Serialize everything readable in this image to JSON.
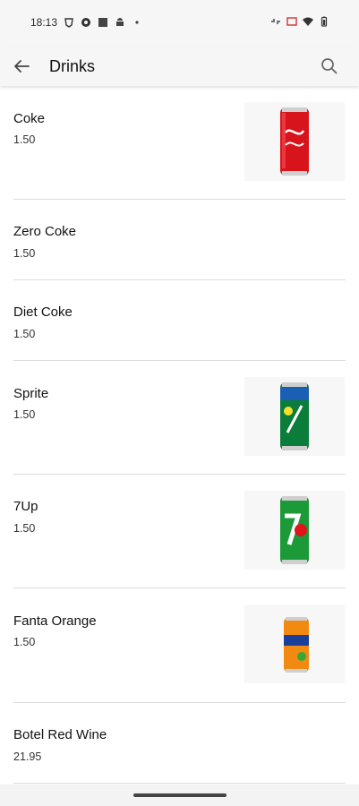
{
  "status_bar": {
    "time": "18:13",
    "left_icons": [
      "vpn-key-icon",
      "settings-icon",
      "square-app-icon",
      "android-icon",
      "dot-icon"
    ],
    "right_icons": [
      "link-icon",
      "cast-icon",
      "wifi-icon",
      "battery-icon"
    ]
  },
  "app_bar": {
    "title": "Drinks",
    "back_icon": "arrow-left-icon",
    "search_icon": "search-icon"
  },
  "items": [
    {
      "name": "Coke",
      "price": "1.50",
      "image": "coke-can"
    },
    {
      "name": "Zero Coke",
      "price": "1.50",
      "image": ""
    },
    {
      "name": "Diet Coke",
      "price": "1.50",
      "image": ""
    },
    {
      "name": "Sprite",
      "price": "1.50",
      "image": "sprite-can"
    },
    {
      "name": "7Up",
      "price": "1.50",
      "image": "7up-can"
    },
    {
      "name": "Fanta Orange",
      "price": "1.50",
      "image": "fanta-can"
    },
    {
      "name": "Botel Red Wine",
      "price": "21.95",
      "image": ""
    }
  ],
  "colors": {
    "coke": "#d7141b",
    "sprite": "#0b7d3a",
    "sevenup": "#1b9a37",
    "fanta": "#f28a12"
  }
}
